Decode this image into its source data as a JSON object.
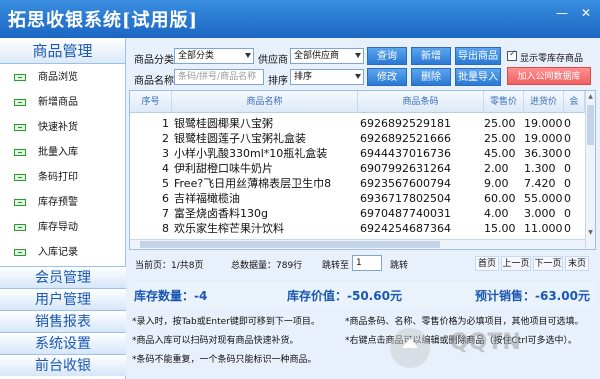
{
  "app": {
    "title": "拓思收银系统[试用版]"
  },
  "sidebar": {
    "header": "商品管理",
    "items": [
      {
        "label": "商品浏览"
      },
      {
        "label": "新增商品"
      },
      {
        "label": "快速补货"
      },
      {
        "label": "批量入库"
      },
      {
        "label": "条码打印"
      },
      {
        "label": "库存预警"
      },
      {
        "label": "库存导动"
      },
      {
        "label": "入库记录"
      }
    ],
    "groups": [
      {
        "label": "会员管理"
      },
      {
        "label": "用户管理"
      },
      {
        "label": "销售报表"
      },
      {
        "label": "系统设置"
      },
      {
        "label": "前台收银"
      }
    ]
  },
  "toolbar": {
    "category_label": "商品分类",
    "category_value": "全部分类",
    "supplier_label": "供应商",
    "supplier_value": "全部供应商",
    "name_label": "商品名称",
    "name_placeholder": "条码/拼号/商品名称",
    "sort_label": "排序",
    "sort_value": "排序",
    "query": "查询",
    "add": "新增",
    "export": "导出商品",
    "edit": "修改",
    "delete": "删除",
    "import": "批量导入",
    "public_db": "加入公网数据库",
    "zero_stock_label": "显示零库存商品",
    "zero_stock_checked": true
  },
  "table": {
    "headers": [
      "序号",
      "商品名称",
      "商品条码",
      "零售价",
      "进货价",
      "会"
    ],
    "rows": [
      [
        "1",
        "银鹭桂圆椰果八宝粥",
        "6926892529181",
        "25.00",
        "19.000",
        "0"
      ],
      [
        "2",
        "银鹭桂圆莲子八宝粥礼盒装",
        "6926892521666",
        "25.00",
        "19.000",
        "0"
      ],
      [
        "3",
        "小样小乳酸330ml*10瓶礼盒装",
        "6944437016736",
        "45.00",
        "36.300",
        "0"
      ],
      [
        "4",
        "伊利甜橙口味牛奶片",
        "6907992631264",
        "2.00",
        "1.300",
        "0"
      ],
      [
        "5",
        "Free?飞日用丝薄棉表层卫生巾8",
        "6923567600794",
        "9.00",
        "7.420",
        "0"
      ],
      [
        "6",
        "吉祥福橄榄油",
        "6936717802504",
        "60.00",
        "55.000",
        "0"
      ],
      [
        "7",
        "富圣烧卤香料130g",
        "6970487740031",
        "4.00",
        "3.000",
        "0"
      ],
      [
        "8",
        "欢乐家生榨芒果汁饮料",
        "6924254687364",
        "15.00",
        "11.000",
        "0"
      ]
    ]
  },
  "pagination": {
    "current": "当前页：1/共8页",
    "total": "总数据量：789行",
    "jump_label": "跳转至",
    "jump_value": "1",
    "jump_btn": "跳转",
    "first": "首页",
    "prev": "上一页",
    "next": "下一页",
    "last": "末页"
  },
  "summary": {
    "stock_qty": "库存数量：-4",
    "stock_value": "库存价值：-50.60元",
    "expected_sales": "预计销售：-63.00元"
  },
  "notes": {
    "n1": "*录入时，按Tab或Enter键即可移到下一项目。",
    "n2": "*商品条码、名称、零售价格为必填项目，其他项目可选填。",
    "n3": "*商品入库可以扫码对现有商品快速补货。",
    "n4": "*右键点击商品可以编辑或删除商品（按住Ctrl可多选中）。",
    "n5": "*条码不能重复，一个条码只能标识一种商品。"
  },
  "watermark": {
    "text": "QQTN"
  },
  "colors": {
    "titlebar": "#1b66c2",
    "accent": "#1a58b3",
    "pink": "#f06060"
  }
}
